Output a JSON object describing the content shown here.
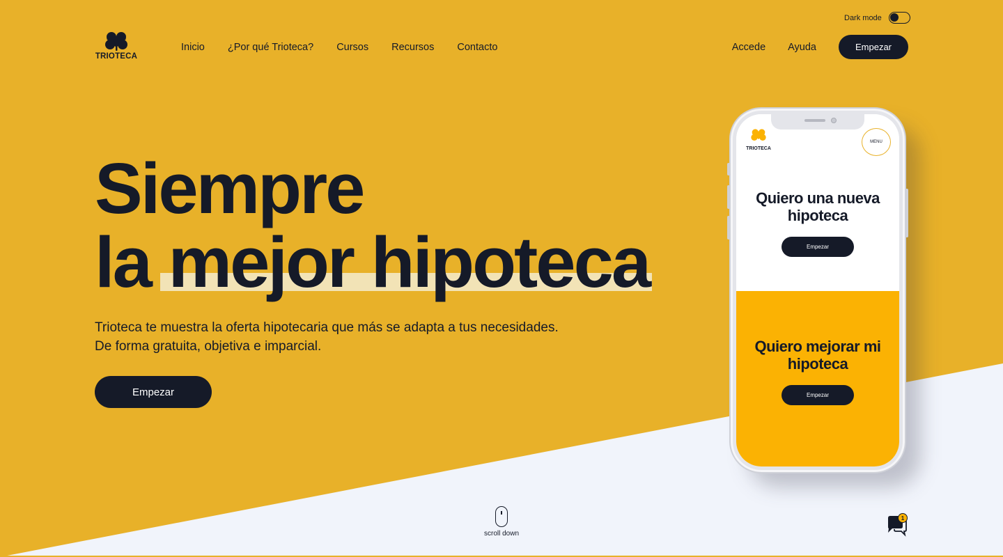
{
  "colors": {
    "background_yellow": "#e8b129",
    "bottom_white": "#f1f4fb",
    "dark_navy": "#151a28",
    "highlight": "#f2e3b6",
    "phone_yellow": "#fbb203"
  },
  "dark_mode": {
    "label": "Dark mode",
    "enabled": false
  },
  "header": {
    "logo_text": "TRIOTECA",
    "nav": [
      {
        "label": "Inicio"
      },
      {
        "label": "¿Por qué Trioteca?"
      },
      {
        "label": "Cursos"
      },
      {
        "label": "Recursos"
      },
      {
        "label": "Contacto"
      }
    ],
    "login_label": "Accede",
    "help_label": "Ayuda",
    "cta_label": "Empezar"
  },
  "hero": {
    "title_line1": "Siempre",
    "title_line2_a": "la",
    "title_line2_b": "mejor hipoteca",
    "subtitle_line1": "Trioteca te muestra la oferta hipotecaria que más se adapta a tus necesidades.",
    "subtitle_line2": "De forma gratuita, objetiva e imparcial.",
    "cta_label": "Empezar"
  },
  "phone": {
    "logo_text": "TRIOTECA",
    "menu_label": "MENU",
    "card1_title": "Quiero una nueva hipoteca",
    "card1_cta": "Empezar",
    "card2_title": "Quiero mejorar mi hipoteca",
    "card2_cta": "Empezar"
  },
  "scroll": {
    "label": "scroll down",
    "icon": "mouse-icon"
  },
  "chat": {
    "icon": "chat-bubbles-icon",
    "badge_count": "1"
  }
}
